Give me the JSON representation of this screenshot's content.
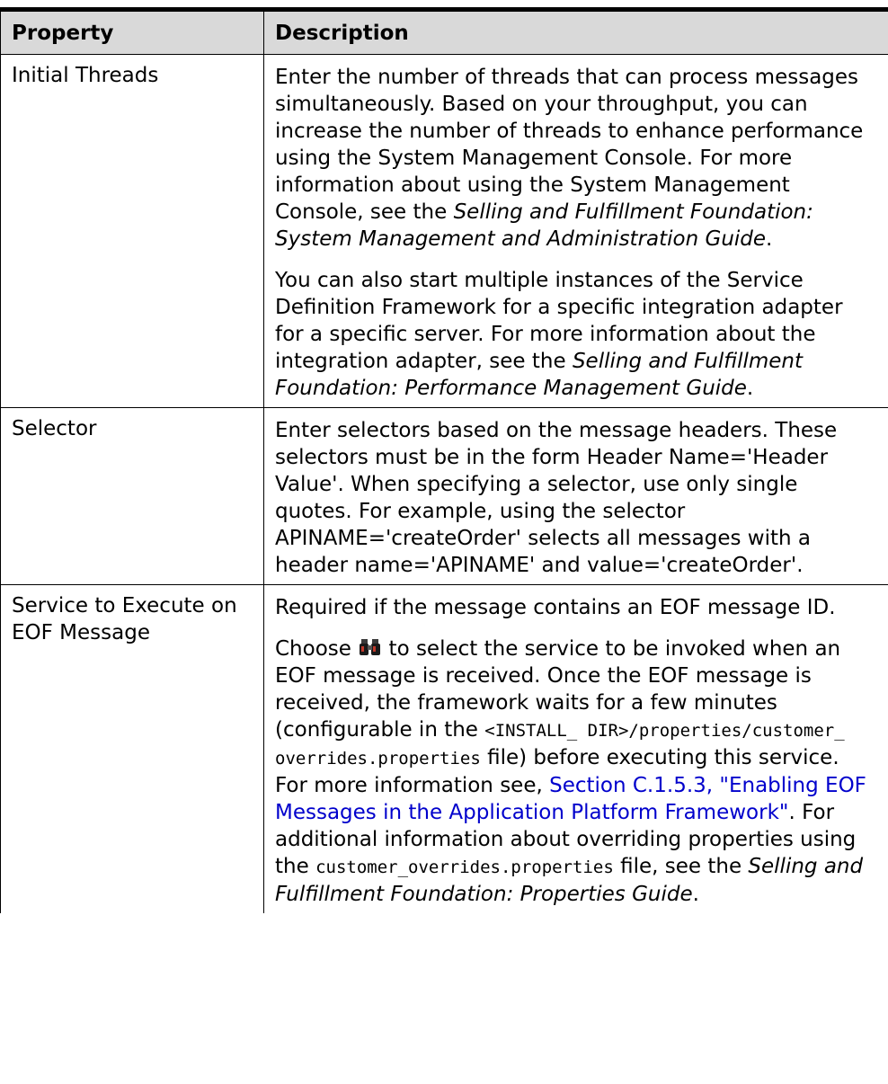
{
  "table": {
    "headers": [
      "Property",
      "Description"
    ],
    "rows": {
      "initial_threads": {
        "property": "Initial Threads",
        "p1": {
          "text": "Enter the number of threads that can process messages simultaneously. Based on your throughput, you can increase the number of threads to enhance performance using the System Management Console. For more information about using the System Management Console, see the ",
          "ref": "Selling and Fulfillment Foundation: System Management and Administration Guide",
          "end": "."
        },
        "p2": {
          "text": "You can also start multiple instances of the Service Definition Framework for a specific integration adapter for a specific server. For more information about the integration adapter, see the ",
          "ref": "Selling and Fulfillment Foundation: Performance Management Guide",
          "end": "."
        }
      },
      "selector": {
        "property": "Selector",
        "p1": "Enter selectors based on the message headers. These selectors must be in the form Header Name='Header Value'. When specifying a selector, use only single quotes. For example, using the selector APINAME='createOrder' selects all messages with a header name='APINAME' and value='createOrder'."
      },
      "service_eof": {
        "property": "Service to Execute on EOF Message",
        "p1": "Required if the message contains an EOF message ID.",
        "p2": {
          "choose": "Choose",
          "icon": "binoculars-icon",
          "t1": "to select the service to be invoked when an EOF message is received. Once the EOF message is received, the framework waits for a few minutes (configurable in the ",
          "code1": "<INSTALL_ DIR>/properties/customer_ overrides.properties",
          "t2": " file) before executing this service. For more information see, ",
          "link": "Section C.1.5.3, \"Enabling EOF Messages in the Application Platform Framework\"",
          "t3": ". For additional information about overriding properties using the ",
          "code2": "customer_overrides.properties",
          "t4": " file, see the ",
          "ref": "Selling and Fulfillment Foundation: Properties Guide",
          "end": "."
        }
      }
    }
  },
  "colors": {
    "header_bg": "#d9d9d9",
    "link": "#0000cc",
    "border": "#000000"
  }
}
